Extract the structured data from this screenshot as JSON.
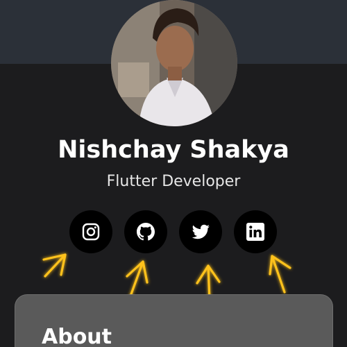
{
  "profile": {
    "name": "Nishchay Shakya",
    "role": "Flutter Developer",
    "avatar_icon": "profile-photo"
  },
  "social": [
    {
      "name": "instagram",
      "icon": "instagram-icon"
    },
    {
      "name": "github",
      "icon": "github-icon"
    },
    {
      "name": "twitter",
      "icon": "twitter-icon"
    },
    {
      "name": "linkedin",
      "icon": "linkedin-icon"
    }
  ],
  "about": {
    "title": "About"
  },
  "colors": {
    "background": "#1c1c1e",
    "top_band": "#2b3038",
    "card": "#5a5a5a",
    "arrow": "#ffc21a"
  }
}
